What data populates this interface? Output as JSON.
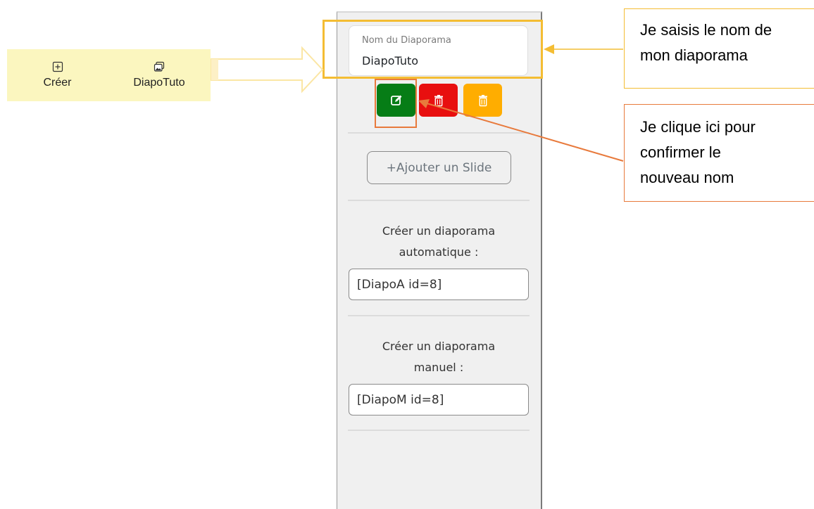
{
  "toolbar": {
    "tabs": [
      {
        "label": "Créer",
        "icon": "plus-square-icon"
      },
      {
        "label": "DiapoTuto",
        "icon": "slideshow-icon"
      }
    ]
  },
  "panel": {
    "name_field": {
      "label": "Nom du Diaporama",
      "value": "DiapoTuto"
    },
    "buttons": [
      {
        "icon": "edit-icon",
        "color": "#067d16"
      },
      {
        "icon": "trash-icon",
        "color": "#e80f0f"
      },
      {
        "icon": "trash-icon",
        "color": "#ffad00"
      }
    ],
    "add_slide_label": "+Ajouter un Slide",
    "auto": {
      "title_line1": "Créer un diaporama",
      "title_line2": "automatique :",
      "shortcode": "[DiapoA id=8]"
    },
    "manual": {
      "title_line1": "Créer un diaporama",
      "title_line2": "manuel :",
      "shortcode": "[DiapoM id=8]"
    }
  },
  "annotations": {
    "name": {
      "line1": "Je saisis le nom de",
      "line2": "mon diaporama",
      "color": "#f4bd33"
    },
    "confirm": {
      "line1": "Je clique ici pour",
      "line2": "confirmer le",
      "line3": "nouveau nom",
      "color": "#e87a3c"
    }
  }
}
